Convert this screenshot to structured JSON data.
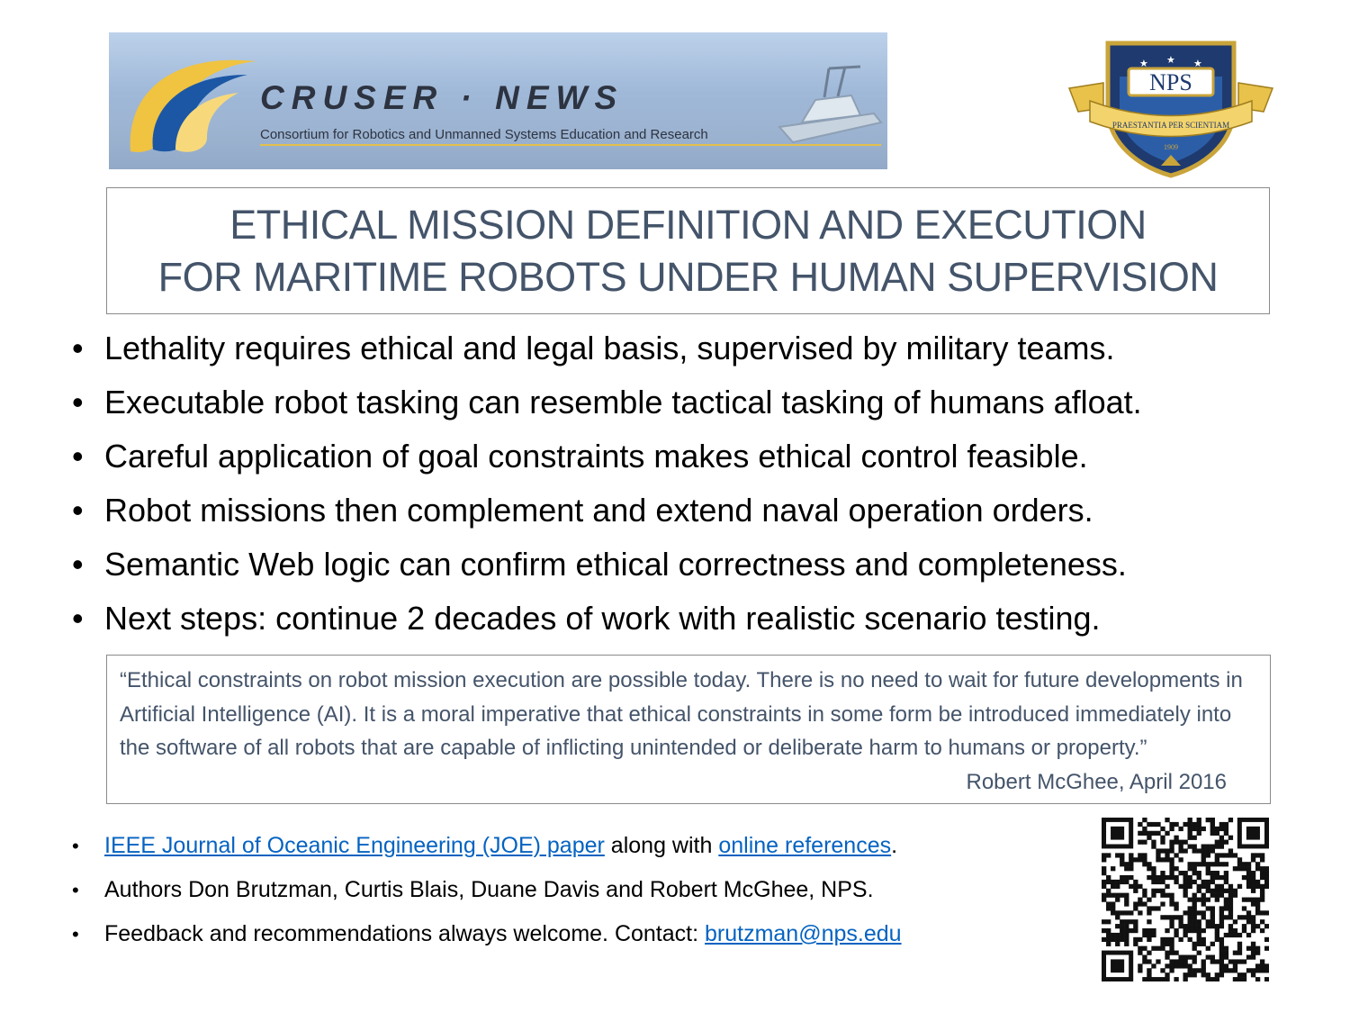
{
  "banner": {
    "title": "CRUSER · NEWS",
    "subtitle": "Consortium for Robotics and Unmanned Systems Education and Research"
  },
  "logo": {
    "initials": "NPS",
    "motto": "PRAESTANTIA PER SCIENTIAM",
    "year": "1909"
  },
  "title": {
    "line1": "ETHICAL MISSION DEFINITION AND EXECUTION",
    "line2": "FOR MARITIME ROBOTS UNDER HUMAN SUPERVISION"
  },
  "bullets": [
    "Lethality requires ethical and legal basis, supervised by military teams.",
    "Executable robot tasking can resemble tactical tasking of humans afloat.",
    "Careful application of goal constraints makes ethical control feasible.",
    "Robot missions then complement and extend naval operation orders.",
    "Semantic Web logic can confirm ethical correctness and completeness.",
    "Next steps: continue 2 decades of work with realistic scenario testing."
  ],
  "quote": {
    "text": "“Ethical constraints on robot mission execution are possible today. There is no need to wait for future developments in Artificial Intelligence (AI). It is a moral imperative that ethical constraints in some form be introduced immediately into the software of all robots that are capable of inflicting unintended or deliberate harm to humans or property.”",
    "author": "Robert McGhee, April 2016"
  },
  "footer": {
    "item1": {
      "link1": "IEEE Journal of Oceanic Engineering (JOE) paper",
      "middle": " along with ",
      "link2": "online references",
      "end": "."
    },
    "item2": "Authors Don Brutzman, Curtis Blais, Duane Davis and Robert McGhee, NPS.",
    "item3": {
      "text": "Feedback and recommendations always welcome. Contact: ",
      "email": "brutzman@nps.edu"
    }
  },
  "bullet_char": "•",
  "colors": {
    "title_text": "#44546a",
    "link": "#0563c1",
    "border": "#8a8a8a",
    "banner_gold": "#e3c04b",
    "logo_navy": "#1f3a6e"
  },
  "icons": [
    "cruser-swoosh-logo",
    "boat-image",
    "nps-crest-logo",
    "qr-code"
  ]
}
